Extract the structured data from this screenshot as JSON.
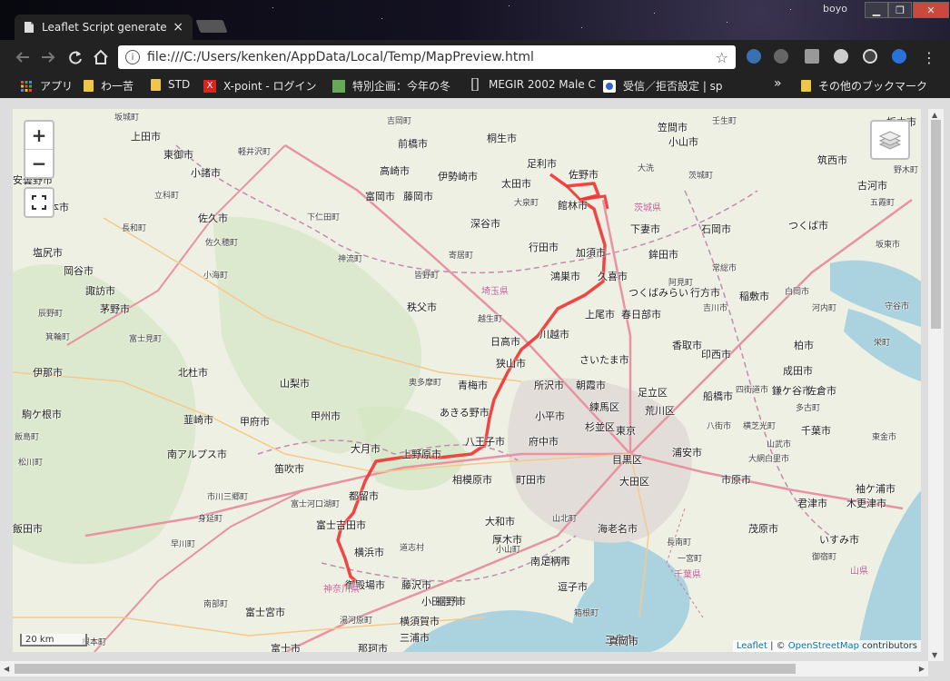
{
  "browser": {
    "tab_title": "Leaflet Script generate",
    "tab_close": "×",
    "window_user": "boyo",
    "window_controls": {
      "minimize": "▁",
      "maximize": "❐",
      "close": "✕"
    },
    "url": "file:///C:/Users/kenken/AppData/Local/Temp/MapPreview.html",
    "bookmarks": [
      {
        "label": "アプリ",
        "icon": "apps-grid-icon"
      },
      {
        "label": "わ一苦",
        "icon": "folder-icon"
      },
      {
        "label": "STD",
        "icon": "folder-icon"
      },
      {
        "label": "X-point - ログイン",
        "icon": "xpoint-icon"
      },
      {
        "label": "特別企画：今年の冬",
        "icon": "site-icon"
      },
      {
        "label": "MEGIR 2002 Male C",
        "icon": "watch-icon"
      },
      {
        "label": "受信／拒否設定 | sp",
        "icon": "site-icon"
      }
    ],
    "bookmarks_overflow": "»",
    "other_bookmarks": "その他のブックマーク"
  },
  "map": {
    "zoom_in": "+",
    "zoom_out": "−",
    "scale_label": "20 km",
    "attribution": {
      "leaflet": "Leaflet",
      "separator": " | © ",
      "osm": "OpenStreetMap",
      "suffix": " contributors"
    },
    "cities": [
      {
        "name": "坂城町",
        "small": true
      },
      {
        "name": "上田市"
      },
      {
        "name": "東御市"
      },
      {
        "name": "軽井沢町",
        "small": true
      },
      {
        "name": "小諸市"
      },
      {
        "name": "立科町",
        "small": true
      },
      {
        "name": "安曇野市"
      },
      {
        "name": "本市"
      },
      {
        "name": "佐久市"
      },
      {
        "name": "長和町",
        "small": true
      },
      {
        "name": "佐久穂町",
        "small": true
      },
      {
        "name": "塩尻市"
      },
      {
        "name": "岡谷市"
      },
      {
        "name": "小海町",
        "small": true
      },
      {
        "name": "諏訪市"
      },
      {
        "name": "辰野町",
        "small": true
      },
      {
        "name": "茅野市"
      },
      {
        "name": "箕輪町",
        "small": true
      },
      {
        "name": "富士見町",
        "small": true
      },
      {
        "name": "伊那市"
      },
      {
        "name": "北杜市"
      },
      {
        "name": "駒ケ根市"
      },
      {
        "name": "韮崎市"
      },
      {
        "name": "飯島町",
        "small": true
      },
      {
        "name": "甲府市"
      },
      {
        "name": "松川町",
        "small": true
      },
      {
        "name": "南アルプス市"
      },
      {
        "name": "甲州市"
      },
      {
        "name": "山梨市"
      },
      {
        "name": "笛吹市"
      },
      {
        "name": "市川三郷町",
        "small": true
      },
      {
        "name": "身延町",
        "small": true
      },
      {
        "name": "早川町",
        "small": true
      },
      {
        "name": "飯田市"
      },
      {
        "name": "南部町",
        "small": true
      },
      {
        "name": "富士宮市"
      },
      {
        "name": "富士市"
      },
      {
        "name": "根本町",
        "small": true
      },
      {
        "name": "高崎市"
      },
      {
        "name": "前橋市"
      },
      {
        "name": "吉岡町",
        "small": true
      },
      {
        "name": "桐生市"
      },
      {
        "name": "伊勢崎市"
      },
      {
        "name": "富岡市"
      },
      {
        "name": "藤岡市"
      },
      {
        "name": "下仁田町",
        "small": true
      },
      {
        "name": "太田市"
      },
      {
        "name": "足利市"
      },
      {
        "name": "佐野市"
      },
      {
        "name": "大泉町",
        "small": true
      },
      {
        "name": "館林市"
      },
      {
        "name": "深谷市"
      },
      {
        "name": "神流町",
        "small": true
      },
      {
        "name": "皆野町",
        "small": true
      },
      {
        "name": "寄居町",
        "small": true
      },
      {
        "name": "行田市"
      },
      {
        "name": "鴻巣市"
      },
      {
        "name": "加須市"
      },
      {
        "name": "久喜市"
      },
      {
        "name": "秩父市"
      },
      {
        "name": "越生町",
        "small": true
      },
      {
        "name": "埼玉県",
        "pref": true
      },
      {
        "name": "日高市"
      },
      {
        "name": "川越市"
      },
      {
        "name": "狭山市"
      },
      {
        "name": "上尾市"
      },
      {
        "name": "春日部市"
      },
      {
        "name": "さいたま市"
      },
      {
        "name": "所沢市"
      },
      {
        "name": "朝霞市"
      },
      {
        "name": "足立区"
      },
      {
        "name": "奥多摩町",
        "small": true
      },
      {
        "name": "青梅市"
      },
      {
        "name": "あきる野市"
      },
      {
        "name": "小平市"
      },
      {
        "name": "練馬区"
      },
      {
        "name": "荒川区"
      },
      {
        "name": "杉並区"
      },
      {
        "name": "八王子市"
      },
      {
        "name": "府中市"
      },
      {
        "name": "東京"
      },
      {
        "name": "大月市"
      },
      {
        "name": "上野原市"
      },
      {
        "name": "相模原市"
      },
      {
        "name": "町田市"
      },
      {
        "name": "目黒区"
      },
      {
        "name": "大田区"
      },
      {
        "name": "浦安市"
      },
      {
        "name": "都留市"
      },
      {
        "name": "富士河口湖町",
        "small": true
      },
      {
        "name": "富士吉田市"
      },
      {
        "name": "道志村",
        "small": true
      },
      {
        "name": "山北町",
        "small": true
      },
      {
        "name": "大和市"
      },
      {
        "name": "厚木市"
      },
      {
        "name": "海老名市"
      },
      {
        "name": "横浜市"
      },
      {
        "name": "小山町",
        "small": true
      },
      {
        "name": "松田町",
        "small": true
      },
      {
        "name": "藤沢市"
      },
      {
        "name": "御殿場市"
      },
      {
        "name": "南足柄市"
      },
      {
        "name": "神奈川県",
        "pref": true
      },
      {
        "name": "小田原市"
      },
      {
        "name": "逗子市"
      },
      {
        "name": "裾野市"
      },
      {
        "name": "箱根町",
        "small": true
      },
      {
        "name": "湯河原町",
        "small": true
      },
      {
        "name": "横須賀市"
      },
      {
        "name": "三浦市"
      },
      {
        "name": "三島市"
      },
      {
        "name": "真岡市"
      },
      {
        "name": "那珂市"
      },
      {
        "name": "壬生町",
        "small": true
      },
      {
        "name": "栃木市"
      },
      {
        "name": "笠間市"
      },
      {
        "name": "小山市"
      },
      {
        "name": "筑西市"
      },
      {
        "name": "大洗",
        "small": true
      },
      {
        "name": "茨城町",
        "small": true
      },
      {
        "name": "野木町",
        "small": true
      },
      {
        "name": "古河市"
      },
      {
        "name": "茨城県",
        "pref": true
      },
      {
        "name": "下妻市"
      },
      {
        "name": "五霞町",
        "small": true
      },
      {
        "name": "石岡市"
      },
      {
        "name": "鉾田市"
      },
      {
        "name": "つくば市"
      },
      {
        "name": "坂東市",
        "small": true
      },
      {
        "name": "常総市",
        "small": true
      },
      {
        "name": "阿見町",
        "small": true
      },
      {
        "name": "行方市"
      },
      {
        "name": "白岡市",
        "small": true
      },
      {
        "name": "守谷市",
        "small": true
      },
      {
        "name": "つくばみらい"
      },
      {
        "name": "稲敷市"
      },
      {
        "name": "吉川市",
        "small": true
      },
      {
        "name": "河内町",
        "small": true
      },
      {
        "name": "香取市"
      },
      {
        "name": "柏市"
      },
      {
        "name": "栄町",
        "small": true
      },
      {
        "name": "印西市"
      },
      {
        "name": "成田市"
      },
      {
        "name": "鎌ケ谷市"
      },
      {
        "name": "佐倉市"
      },
      {
        "name": "船橋市"
      },
      {
        "name": "多古町",
        "small": true
      },
      {
        "name": "四街道市",
        "small": true
      },
      {
        "name": "八街市",
        "small": true
      },
      {
        "name": "横芝光町",
        "small": true
      },
      {
        "name": "千葉市"
      },
      {
        "name": "山武市",
        "small": true
      },
      {
        "name": "東金市",
        "small": true
      },
      {
        "name": "大網白里市",
        "small": true
      },
      {
        "name": "市原市"
      },
      {
        "name": "袖ケ浦市"
      },
      {
        "name": "木更津市"
      },
      {
        "name": "君津市"
      },
      {
        "name": "茂原市"
      },
      {
        "name": "長南町",
        "small": true
      },
      {
        "name": "一宮町",
        "small": true
      },
      {
        "name": "千葉県",
        "pref": true
      },
      {
        "name": "いすみ市"
      },
      {
        "name": "御宿町",
        "small": true
      },
      {
        "name": "山県",
        "pref": true
      }
    ]
  }
}
